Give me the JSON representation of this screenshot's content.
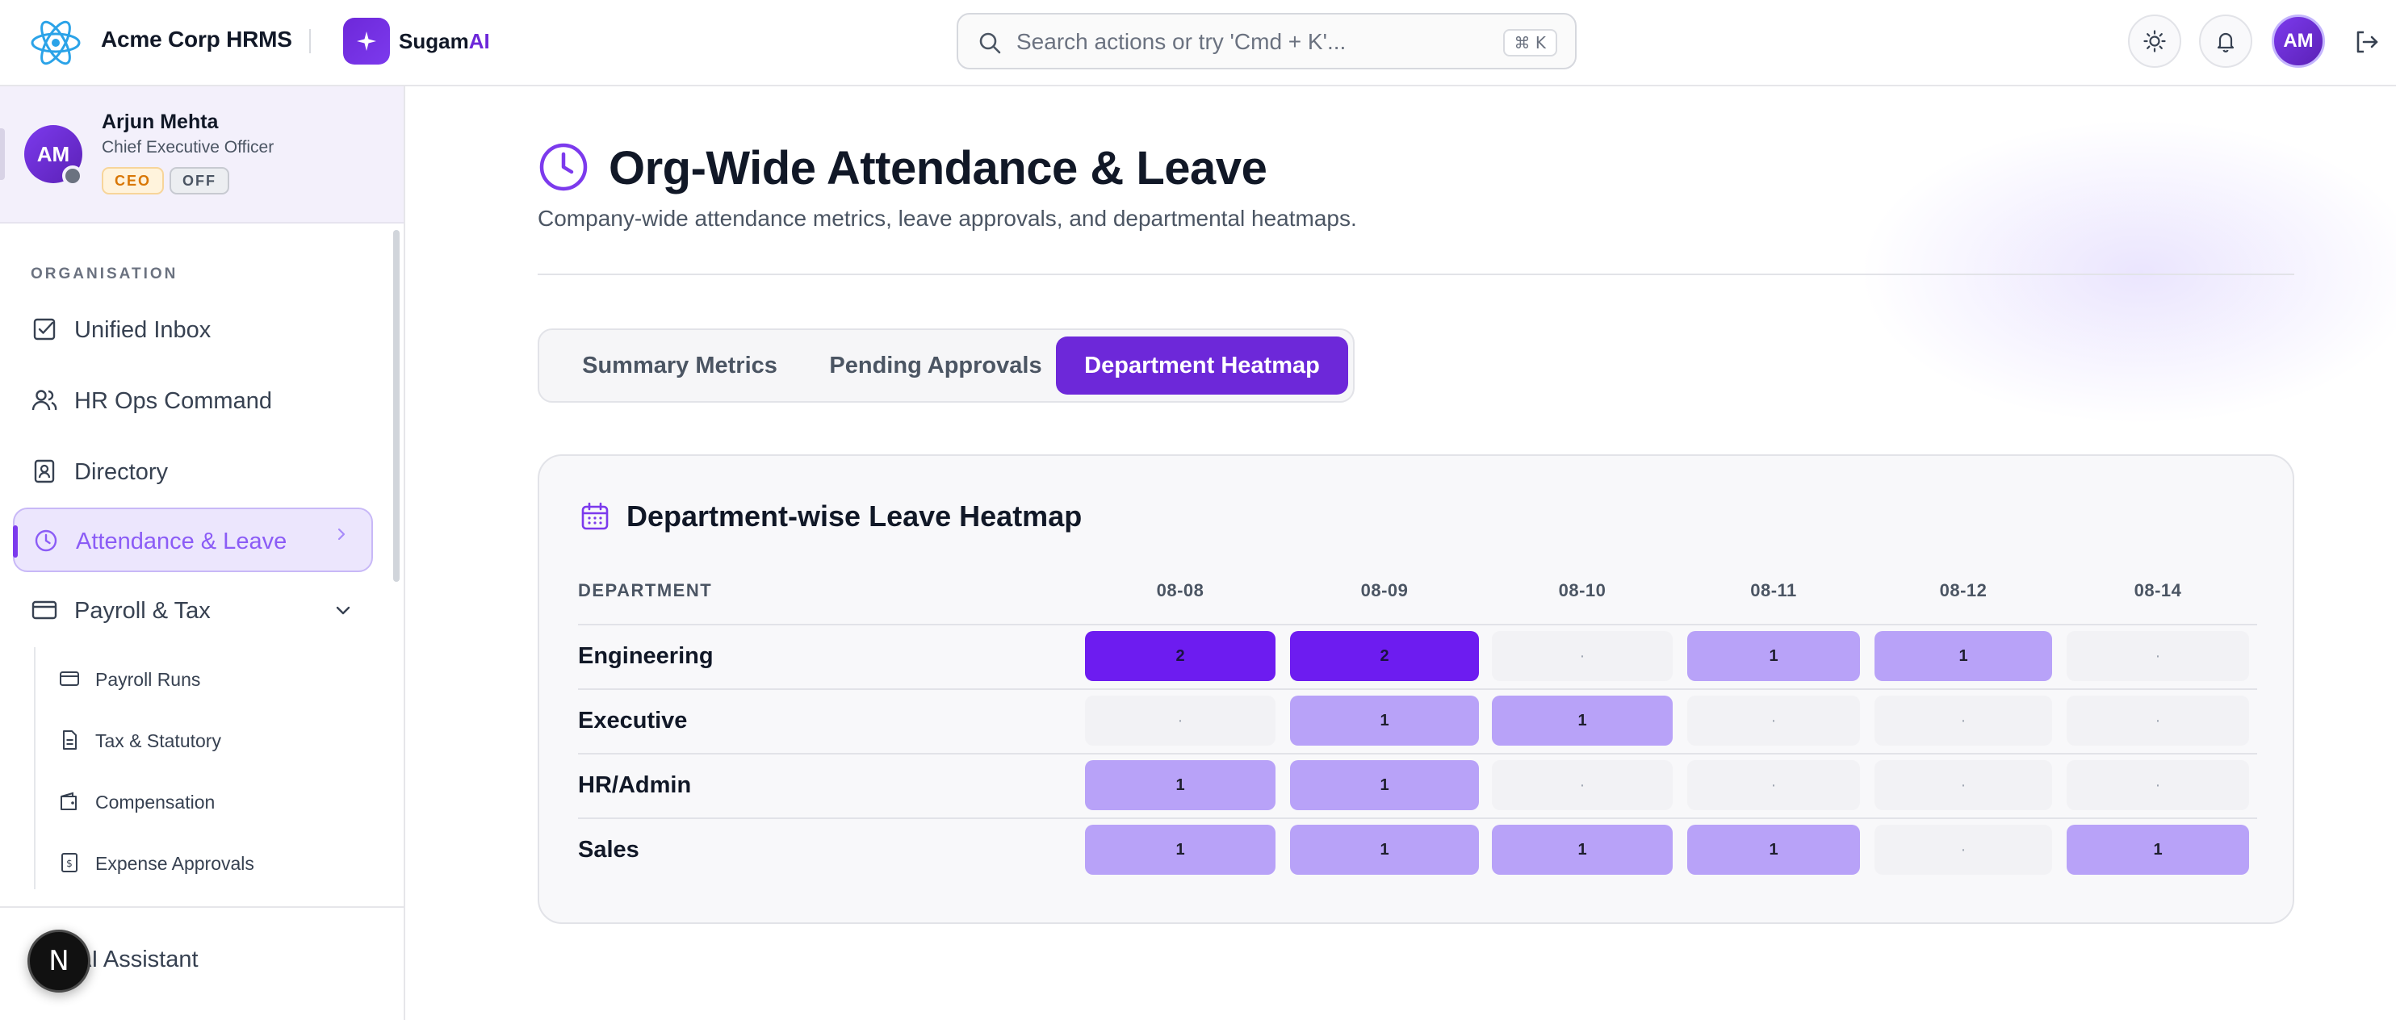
{
  "app": {
    "name": "Acme Corp HRMS",
    "sugam_prefix": "Sugam",
    "sugam_suffix": "AI",
    "icons": {
      "brand": "react-atom-icon",
      "sugam": "sparkle-icon"
    }
  },
  "search": {
    "placeholder": "Search actions or try 'Cmd + K'...",
    "shortcut": "⌘ K"
  },
  "topbar": {
    "avatar_initials": "AM",
    "icons": [
      "sun-icon",
      "bell-icon",
      "logout-icon"
    ]
  },
  "profile": {
    "initials": "AM",
    "name": "Arjun Mehta",
    "role": "Chief Executive Officer",
    "tag_role": "CEO",
    "tag_status": "OFF"
  },
  "sidebar": {
    "section_label": "ORGANISATION",
    "items": [
      {
        "label": "Unified Inbox",
        "icon": "checkbox-icon"
      },
      {
        "label": "HR Ops Command",
        "icon": "users-icon"
      },
      {
        "label": "Directory",
        "icon": "id-card-icon"
      },
      {
        "label": "Attendance & Leave",
        "icon": "clock-icon",
        "active": true
      },
      {
        "label": "Payroll & Tax",
        "icon": "credit-card-icon",
        "expanded": true
      }
    ],
    "subitems": [
      {
        "label": "Payroll Runs",
        "icon": "card-icon"
      },
      {
        "label": "Tax & Statutory",
        "icon": "document-icon"
      },
      {
        "label": "Compensation",
        "icon": "wallet-icon"
      },
      {
        "label": "Expense Approvals",
        "icon": "receipt-icon"
      }
    ],
    "assistant_label": "AI Assistant",
    "n_badge": "N"
  },
  "page": {
    "title": "Org-Wide Attendance & Leave",
    "subtitle": "Company-wide attendance metrics, leave approvals, and departmental heatmaps.",
    "tabs": [
      {
        "label": "Summary Metrics"
      },
      {
        "label": "Pending Approvals"
      },
      {
        "label": "Department Heatmap",
        "active": true
      }
    ]
  },
  "heatmap": {
    "title": "Department-wise Leave Heatmap",
    "department_header": "DEPARTMENT",
    "dates": [
      "08-08",
      "08-09",
      "08-10",
      "08-11",
      "08-12",
      "08-14"
    ],
    "empty_symbol": "·",
    "rows": [
      {
        "department": "Engineering",
        "values": [
          2,
          2,
          0,
          1,
          1,
          0
        ]
      },
      {
        "department": "Executive",
        "values": [
          0,
          1,
          1,
          0,
          0,
          0
        ]
      },
      {
        "department": "HR/Admin",
        "values": [
          1,
          1,
          0,
          0,
          0,
          0
        ]
      },
      {
        "department": "Sales",
        "values": [
          1,
          1,
          1,
          1,
          0,
          1
        ]
      }
    ],
    "colors": {
      "level_0": "#f2f2f5",
      "level_1": "#b8a2f8",
      "level_2": "#6d1cf0"
    }
  }
}
